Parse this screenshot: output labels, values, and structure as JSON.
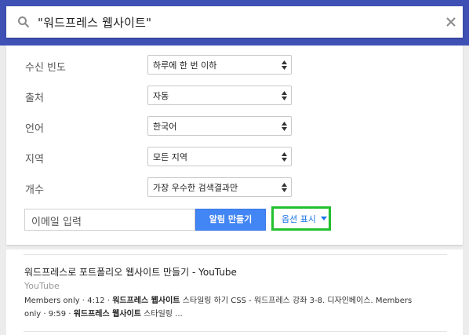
{
  "search": {
    "query": "\"워드프레스 웹사이트\""
  },
  "options": {
    "rows": [
      {
        "label": "수신 빈도",
        "value": "하루에 한 번 이하"
      },
      {
        "label": "출처",
        "value": "자동"
      },
      {
        "label": "언어",
        "value": "한국어"
      },
      {
        "label": "지역",
        "value": "모든 지역"
      },
      {
        "label": "개수",
        "value": "가장 우수한 검색결과만"
      }
    ]
  },
  "actions": {
    "email_placeholder": "이메일 입력",
    "create_label": "알림 만들기",
    "show_options_label": "옵션 표시"
  },
  "results": [
    {
      "title": "워드프레스로 포트폴리오 웹사이트 만들기 - YouTube",
      "source": "YouTube",
      "snippet_line1_pre": "Members only · 4:12 · ",
      "snippet_line1_bold": "워드프레스 웹사이트",
      "snippet_line1_post": " 스타일링 하기 CSS - 워드프레스 강좌 3-8. 디자인베이스. Members",
      "snippet_line2_pre": "only · 9:59 · ",
      "snippet_line2_bold": "워드프레스 웹사이트",
      "snippet_line2_post": " 스타일링 ..."
    }
  ],
  "colors": {
    "header": "#3f51b5",
    "button": "#4285f4",
    "highlight": "#22c02e",
    "link": "#1a73e8"
  },
  "icons": [
    "search-icon",
    "close-icon",
    "select-arrows-icon",
    "caret-down-icon"
  ]
}
